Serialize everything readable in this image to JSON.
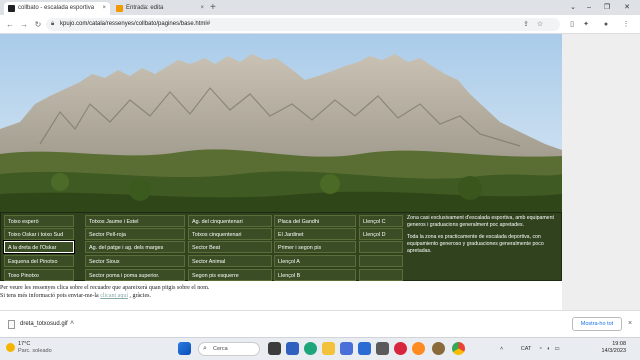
{
  "browser": {
    "tabs": [
      {
        "title": "collbato - escalada esportiva",
        "active": true,
        "favicon_color": "#202124"
      },
      {
        "title": "Entrada: edita",
        "active": false,
        "favicon_color": "#f29900"
      }
    ],
    "new_tab_glyph": "+",
    "close_glyph": "×",
    "address": "kpujo.com/catala/ressenyes/collbato/pagines/base.html#",
    "nav": {
      "back": "←",
      "forward": "→",
      "reload": "↻"
    }
  },
  "sector_table": {
    "columns": [
      [
        "Toixo esperò",
        "Toixo Oskar i toixo Sud",
        "A la dreta de l'Oskar",
        "Esquena del Pinotxo",
        "Toxo Pinotxo"
      ],
      [
        "Totxos Jaume i Estel",
        "Sector Pell-roja",
        "Ag. del patge i ag. dels marges",
        "Sector Sioux",
        "Sector poma i poma superior."
      ],
      [
        "Ag. del cinquentenari",
        "Totxos cinquentenari",
        "Sector Beat",
        "Sector Animal",
        "Segon pis esquerre"
      ],
      [
        "Placa del Gandhi",
        "El Jardinet",
        "Primer i segon pis",
        "Llençol A",
        "Llençol B"
      ],
      [
        "Llençol C",
        "Llençol D",
        "",
        "",
        ""
      ]
    ],
    "selected_cell": "A la dreta de l'Oskar",
    "zones": [
      "Zona casi exclusivament d'escalada esportiva, amb equipament generos i graduacions generalment poc apretades.",
      "Toda la zona es practicamente de escalada deportiva, con equipamiento generoso y graduaciones generalmente poco apretadas."
    ]
  },
  "page_text": {
    "line1": "Per veure les ressenyes clica sobre el recuadre que apareixerà quan pitgis sobre el nom.",
    "line2_before": "Si tens més informació pots enviar-me-la",
    "line2_link": "clicant aquí",
    "line2_after": ", gràcies."
  },
  "downloads": {
    "file": "dreta_totxosud.gif",
    "menu_glyph": "˄",
    "show_all": "Mostra-ho tot",
    "close_glyph": "×"
  },
  "taskbar": {
    "weather_temp": "17°C",
    "weather_desc": "Parc. soleado",
    "search_label": "Cerca",
    "tray_lang": "CAT",
    "time": "19:08",
    "date": "14/3/2023"
  }
}
